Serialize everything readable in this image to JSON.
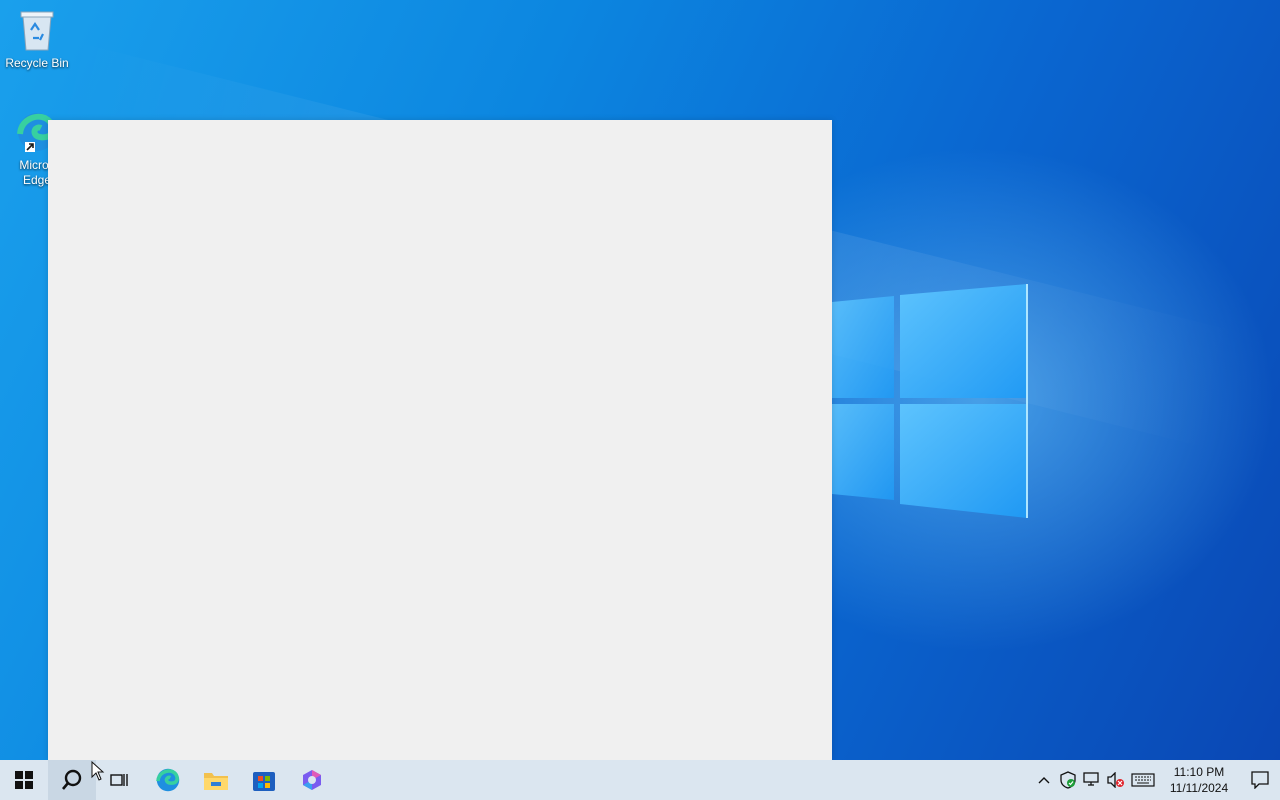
{
  "desktop": {
    "icons": [
      {
        "label": "Recycle Bin",
        "icon": "recycle-bin-icon"
      },
      {
        "label": "Microsoft Edge",
        "label_visible": "Micros\nEdge",
        "icon": "edge-icon"
      }
    ]
  },
  "window": {
    "background": "#f0f0f0"
  },
  "taskbar": {
    "pinned": [
      {
        "icon": "start-icon"
      },
      {
        "icon": "search-icon"
      },
      {
        "icon": "task-view-icon"
      },
      {
        "icon": "edge-icon"
      },
      {
        "icon": "file-explorer-icon"
      },
      {
        "icon": "microsoft-store-icon"
      },
      {
        "icon": "copilot-icon"
      }
    ],
    "tray": {
      "icons": [
        "chevron-up-icon",
        "security-shield-icon",
        "network-icon",
        "volume-muted-icon",
        "keyboard-icon"
      ],
      "time": "11:10 PM",
      "date": "11/11/2024"
    }
  },
  "colors": {
    "wallpaper_primary": "#0c86e0",
    "taskbar": "#dbe6f0"
  }
}
